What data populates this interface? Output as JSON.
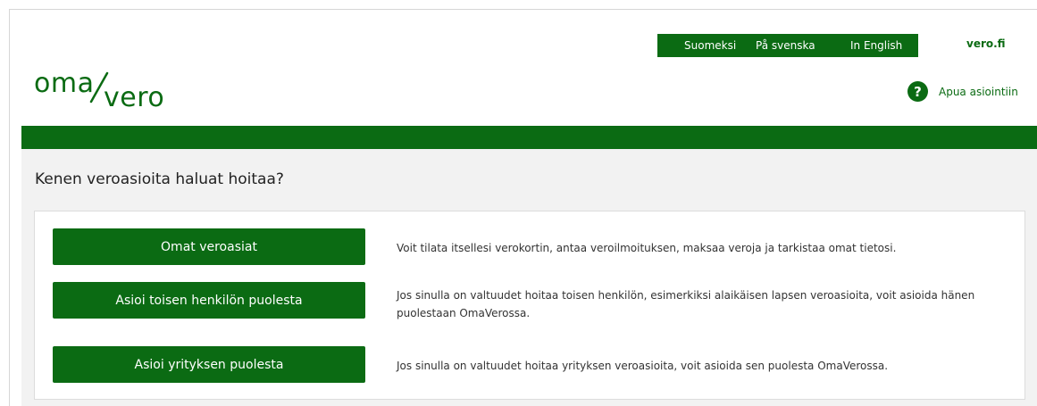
{
  "header": {
    "languages": [
      "Suomeksi",
      "På svenska",
      "In English"
    ],
    "site_link": "vero.fi",
    "logo": {
      "part1": "oma",
      "part2": "vero"
    },
    "help_label": "Apua asiointiin",
    "help_icon": "question-icon"
  },
  "main": {
    "title": "Kenen veroasioita haluat hoitaa?",
    "options": [
      {
        "button_label": "Omat veroasiat",
        "description": "Voit tilata itsellesi verokortin, antaa veroilmoituksen, maksaa veroja ja tarkistaa omat tietosi."
      },
      {
        "button_label": "Asioi toisen henkilön puolesta",
        "description": "Jos sinulla on valtuudet hoitaa toisen henkilön, esimerkiksi alaikäisen lapsen veroasioita, voit asioida hänen puolestaan OmaVerossa."
      },
      {
        "button_label": "Asioi yrityksen puolesta",
        "description": "Jos sinulla on valtuudet hoitaa yrityksen veroasioita, voit asioida sen puolesta OmaVerossa."
      }
    ]
  },
  "colors": {
    "brand_green": "#0b6b13",
    "background_gray": "#f2f2f2"
  }
}
